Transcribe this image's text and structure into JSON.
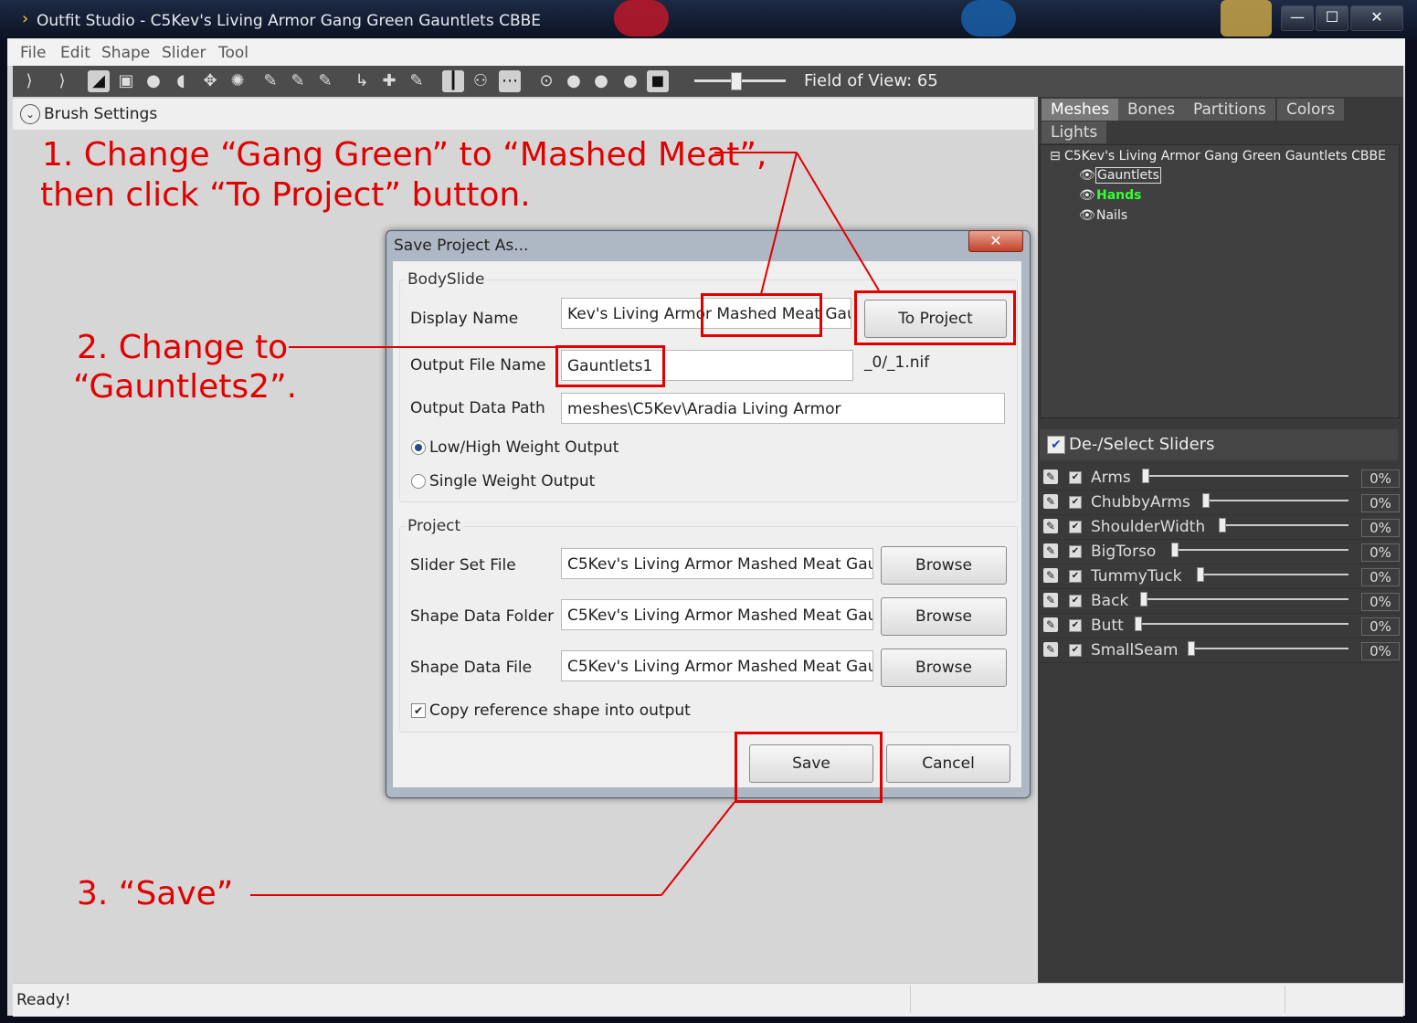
{
  "window": {
    "title": "Outfit Studio - C5Kev's Living Armor Gang Green Gauntlets CBBE",
    "min": "—",
    "max": "☐",
    "close": "✕"
  },
  "menu": [
    "File",
    "Edit",
    "Shape",
    "Slider",
    "Tool"
  ],
  "toolbar": {
    "field_of_view": "Field of View: 65"
  },
  "brush_settings": "Brush Settings",
  "panel_tabs": [
    "Meshes",
    "Bones",
    "Partitions",
    "Colors",
    "Lights"
  ],
  "mesh_tree": {
    "root": "C5Kev's Living Armor Gang Green Gauntlets CBBE",
    "items": [
      "Gauntlets",
      "Hands",
      "Nails"
    ]
  },
  "sliders": {
    "header": "De-/Select Sliders",
    "items": [
      {
        "name": "Arms",
        "value": "0%"
      },
      {
        "name": "ChubbyArms",
        "value": "0%"
      },
      {
        "name": "ShoulderWidth",
        "value": "0%"
      },
      {
        "name": "BigTorso",
        "value": "0%"
      },
      {
        "name": "TummyTuck",
        "value": "0%"
      },
      {
        "name": "Back",
        "value": "0%"
      },
      {
        "name": "Butt",
        "value": "0%"
      },
      {
        "name": "SmallSeam",
        "value": "0%"
      }
    ]
  },
  "status": "Ready!",
  "dialog": {
    "title": "Save Project As...",
    "bodyslide_group": "BodySlide",
    "display_name_label": "Display Name",
    "display_name_value": "Kev's Living Armor Mashed Meat Gau",
    "to_project_button": "To Project",
    "output_file_label": "Output File Name",
    "output_file_value": "Gauntlets1",
    "output_file_suffix": "_0/_1.nif",
    "output_path_label": "Output Data Path",
    "output_path_value": "meshes\\C5Kev\\Aradia Living Armor",
    "radio_lowhigh": "Low/High Weight Output",
    "radio_single": "Single Weight Output",
    "project_group": "Project",
    "slider_set_label": "Slider Set File",
    "slider_set_value": "C5Kev's Living Armor Mashed Meat Gau",
    "shape_folder_label": "Shape Data Folder",
    "shape_folder_value": "C5Kev's Living Armor Mashed Meat Gau",
    "shape_file_label": "Shape Data File",
    "shape_file_value": "C5Kev's Living Armor Mashed Meat Gau",
    "browse": "Browse",
    "copy_ref": "Copy reference shape into output",
    "save": "Save",
    "cancel": "Cancel"
  },
  "annotations": {
    "step1_line1": "1. Change “Gang Green” to “Mashed Meat”,",
    "step1_line2": "then click “To Project” button.",
    "step2_line1": "2. Change to",
    "step2_line2": "“Gauntlets2”.",
    "step3": "3. “Save”",
    "color": "#e00000"
  }
}
